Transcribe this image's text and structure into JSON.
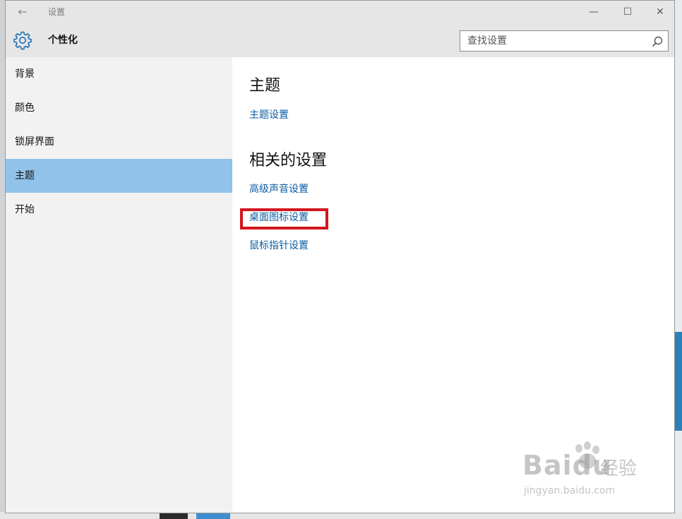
{
  "window": {
    "title": "设置",
    "back_glyph": "←",
    "min_glyph": "—",
    "max_glyph": "☐",
    "close_glyph": "✕"
  },
  "header": {
    "page_title": "个性化",
    "icon": "gear-icon",
    "search": {
      "value": "",
      "placeholder": "查找设置",
      "icon": "search-icon"
    }
  },
  "sidebar": {
    "items": [
      {
        "label": "背景",
        "selected": false
      },
      {
        "label": "颜色",
        "selected": false
      },
      {
        "label": "锁屏界面",
        "selected": false
      },
      {
        "label": "主题",
        "selected": true
      },
      {
        "label": "开始",
        "selected": false
      }
    ]
  },
  "content": {
    "section_theme": {
      "heading": "主题",
      "links": [
        "主题设置"
      ]
    },
    "section_related": {
      "heading": "相关的设置",
      "links": [
        "高级声音设置",
        "桌面图标设置",
        "鼠标指针设置"
      ]
    }
  },
  "annotation": {
    "highlighted_link": "桌面图标设置",
    "color": "#d3151d"
  },
  "watermark": {
    "brand": "Baidu",
    "cn": "经验",
    "url": "jingyan.baidu.com"
  },
  "colors": {
    "accent_selected": "#91c2e9",
    "link": "#0b5da3",
    "header_bg": "#e6e6e6",
    "sidebar_bg": "#f2f2f2"
  }
}
